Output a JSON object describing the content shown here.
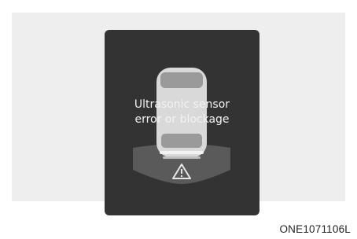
{
  "display": {
    "message_line1": "Ultrasonic sensor",
    "message_line2": "error or blockage",
    "icons": [
      "vehicle-top-view-icon",
      "sensor-zone-arc",
      "warning-triangle-icon"
    ],
    "colors": {
      "screen": "#333333",
      "vehicle_body": "#d9d9d9",
      "sensor_arc": "#5a5a5a"
    }
  },
  "figure": {
    "code": "ONE1071106L"
  }
}
